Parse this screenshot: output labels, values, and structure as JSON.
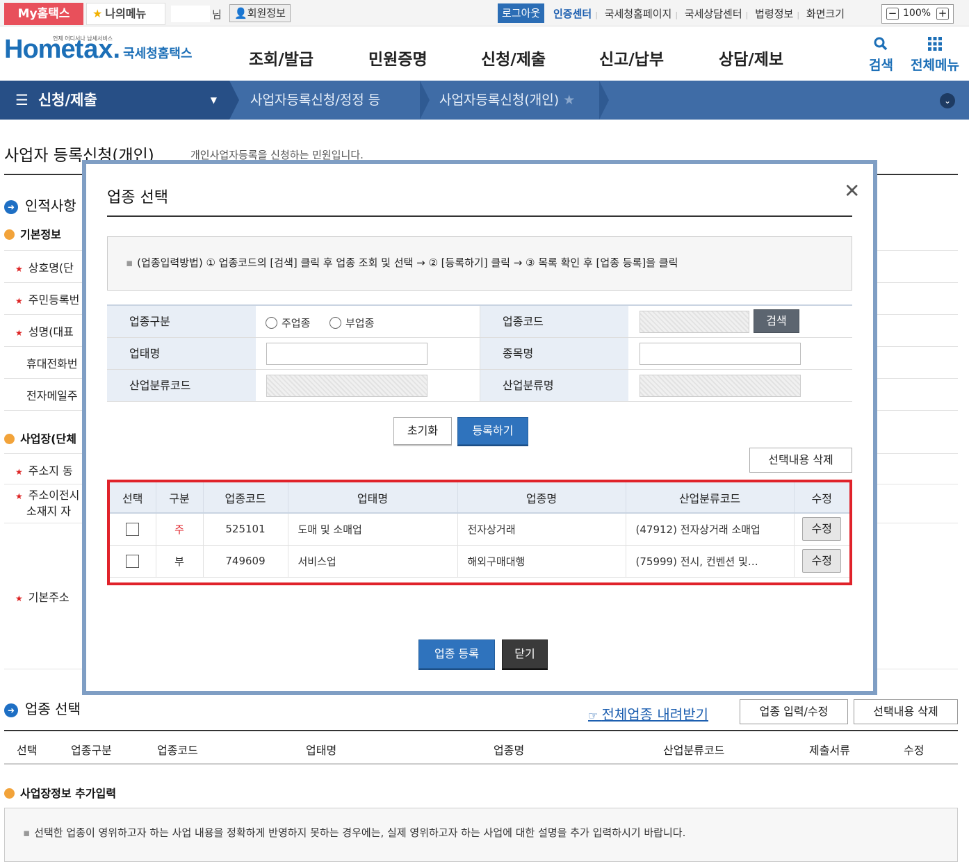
{
  "topbar": {
    "my_hometax": "My홈택스",
    "my_menu": "나의메뉴",
    "nim": "님",
    "member_info": "회원정보",
    "logout": "로그아웃",
    "links": [
      "인증센터",
      "국세청홈페이지",
      "국세상담센터",
      "법령정보",
      "화면크기"
    ],
    "zoom": "100%",
    "zoom_minus": "−",
    "zoom_plus": "+"
  },
  "header": {
    "logo_small": "언제 어디서나 납세서비스",
    "logo_home": "Home",
    "logo_tax": "tax.",
    "logo_kor": "국세청홈택스",
    "nav": [
      "조회/발급",
      "민원증명",
      "신청/제출",
      "신고/납부",
      "상담/제보"
    ],
    "search": "검색",
    "all_menu": "전체메뉴"
  },
  "breadcrumb": {
    "root": "신청/제출",
    "items": [
      "사업자등록신청/정정 등",
      "사업자등록신청(개인)"
    ]
  },
  "page": {
    "title": "사업자 등록신청(개인)",
    "subtitle": "개인사업자등록을 신청하는 민원입니다.",
    "section_person": "인적사항",
    "sub_basic": "기본정보",
    "labels": [
      "상호명(단",
      "주민등록번",
      "성명(대표",
      "휴대전화번",
      "전자메일주"
    ],
    "sub_business": "사업장(단체",
    "addr_labels": [
      "주소지 동",
      "주소이전시",
      "소재지 자"
    ],
    "base_addr": "기본주소",
    "section_industry": "업종 선택",
    "download_link": "전체업종 내려받기",
    "btn_input_edit": "업종 입력/수정",
    "btn_delete_selected": "선택내용 삭제",
    "table_headers": [
      "선택",
      "업종구분",
      "업종코드",
      "업태명",
      "업종명",
      "산업분류코드",
      "제출서류",
      "수정"
    ],
    "sub_extra": "사업장정보 추가입력",
    "info_text": "선택한 업종이 영위하고자 하는 사업 내용을 정확하게 반영하지 못하는 경우에는, 실제 영위하고자 하는 사업에 대한 설명을 추가 입력하시기 바랍니다."
  },
  "modal": {
    "title": "업종 선택",
    "guide": "(업종입력방법) ① 업종코드의 [검색] 클릭 후 업종 조회 및 선택 → ② [등록하기] 클릭 → ③ 목록 확인 후 [업종 등록]을 클릭",
    "form": {
      "type_label": "업종구분",
      "radio_main": "주업종",
      "radio_sub": "부업종",
      "code_label": "업종코드",
      "search_button": "검색",
      "biz_type_label": "업태명",
      "item_label": "종목명",
      "ind_code_label": "산업분류코드",
      "ind_name_label": "산업분류명"
    },
    "reset_button": "초기화",
    "register_button": "등록하기",
    "delete_selected": "선택내용 삭제",
    "table": {
      "headers": [
        "선택",
        "구분",
        "업종코드",
        "업태명",
        "업종명",
        "산업분류코드",
        "수정"
      ],
      "rows": [
        {
          "type": "주",
          "code": "525101",
          "biz": "도매 및 소매업",
          "name": "전자상거래",
          "ind": "(47912) 전자상거래 소매업",
          "edit": "수정"
        },
        {
          "type": "부",
          "code": "749609",
          "biz": "서비스업",
          "name": "해외구매대행",
          "ind": "(75999) 전시, 컨벤션 및…",
          "edit": "수정"
        }
      ]
    },
    "submit_button": "업종 등록",
    "close_button": "닫기"
  },
  "colors": {
    "brand_blue": "#1c6fb7",
    "crumb_bar": "#3f6ca6",
    "highlight_red": "#e0222a",
    "main_type_red": "#e0222a"
  }
}
